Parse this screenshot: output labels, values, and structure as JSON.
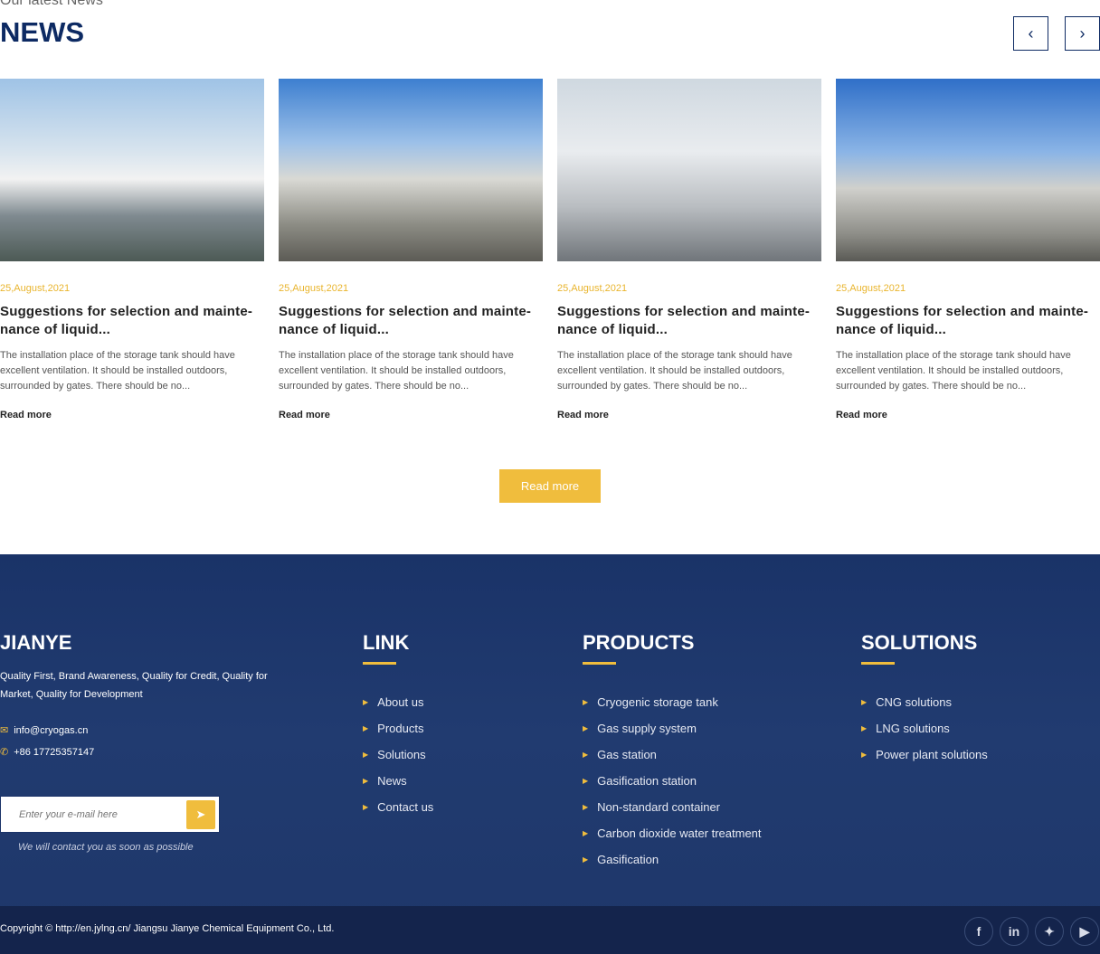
{
  "header": {
    "subtitle": "Our latest News",
    "title": "NEWS",
    "prev_icon": "chevron-left-icon",
    "next_icon": "chevron-right-icon"
  },
  "news": [
    {
      "date": "25,August,2021",
      "title": "Suggestions for selection and mainte-nance of liquid...",
      "desc": "The installation place of the storage tank should have excellent ventilation. It should be installed outdoors, surrounded by gates. There should be no...",
      "more": "Read more"
    },
    {
      "date": "25,August,2021",
      "title": "Suggestions for selection and mainte-nance of liquid...",
      "desc": "The installation place of the storage tank should have excellent ventilation. It should be installed outdoors, surrounded by gates. There should be no...",
      "more": "Read more"
    },
    {
      "date": "25,August,2021",
      "title": "Suggestions for selection and mainte-nance of liquid...",
      "desc": "The installation place of the storage tank should have excellent ventilation. It should be installed outdoors, surrounded by gates. There should be no...",
      "more": "Read more"
    },
    {
      "date": "25,August,2021",
      "title": "Suggestions for selection and mainte-nance of liquid...",
      "desc": "The installation place of the storage tank should have excellent ventilation. It should be installed outdoors, surrounded by gates. There should be no...",
      "more": "Read more"
    }
  ],
  "read_more_button": "Read more",
  "footer": {
    "brand": "JIANYE",
    "tagline": "Quality First, Brand Awareness, Quality for Credit, Quality for Market, Quality for Development",
    "email": "info@cryogas.cn",
    "phone": "+86 17725357147",
    "email_placeholder": "Enter your e-mail here",
    "note": "We will contact you as soon as possible",
    "link": {
      "title": "LINK",
      "items": [
        "About us",
        "Products",
        "Solutions",
        "News",
        "Contact us"
      ]
    },
    "products": {
      "title": "PRODUCTS",
      "items": [
        "Cryogenic storage tank",
        "Gas supply system",
        "Gas station",
        "Gasification station",
        "Non-standard container",
        "Carbon dioxide water treatment",
        "Gasification"
      ]
    },
    "solutions": {
      "title": "SOLUTIONS",
      "items": [
        "CNG solutions",
        "LNG solutions",
        "Power plant solutions"
      ]
    },
    "copyright": "Copyright © http://en.jylng.cn/ Jiangsu Jianye Chemical Equipment Co., Ltd.",
    "social": [
      "facebook-icon",
      "linkedin-icon",
      "twitter-icon",
      "youtube-icon"
    ]
  },
  "colors": {
    "accent": "#f0bd3d",
    "navy": "#0d2a63",
    "footer": "#1a3368"
  }
}
